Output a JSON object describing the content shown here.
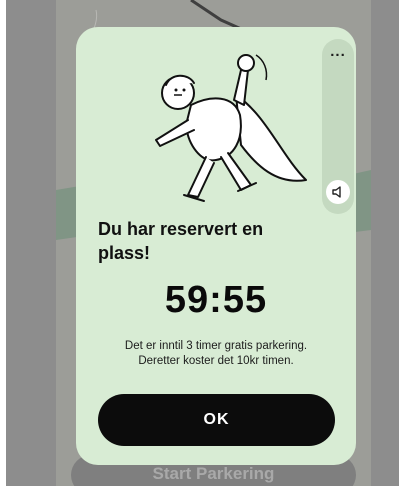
{
  "modal": {
    "title": "Du har reservert en plass!",
    "timer": "59:55",
    "info_line1": "Det er inntil 3 timer gratis parkering.",
    "info_line2": "Deretter koster det 10kr timen.",
    "ok_label": "OK",
    "more_label": "...",
    "illustration": "celebrating-character-illustration"
  },
  "background": {
    "start_button_label": "Start Parkering"
  },
  "colors": {
    "modal_background": "#d8ecd4",
    "primary_button": "#0c0c0c",
    "overlay": "#8d8d8d"
  }
}
